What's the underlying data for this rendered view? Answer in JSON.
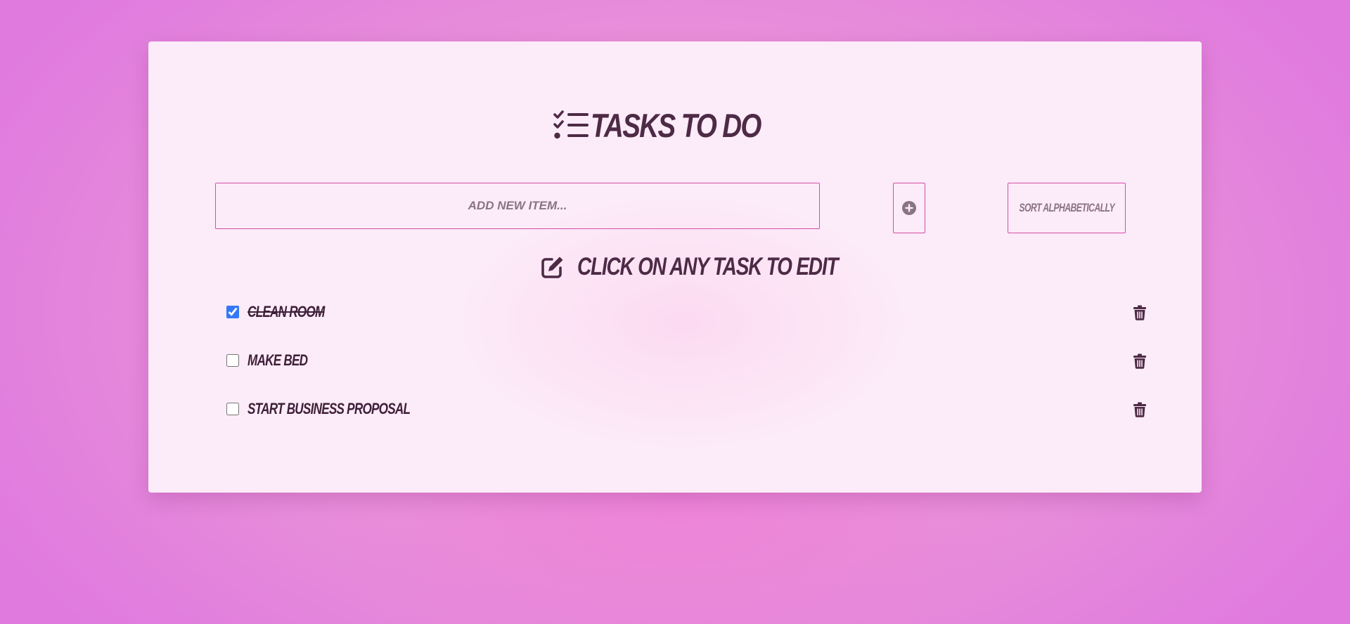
{
  "header": {
    "title": "Tasks To Do",
    "title_icon": "list-check-icon"
  },
  "new_item": {
    "placeholder": "Add new item...",
    "value": ""
  },
  "buttons": {
    "add_icon": "plus-circle-icon",
    "sort_label": "Sort Alphabetically"
  },
  "hint": {
    "icon": "edit-icon",
    "text": "Click on any task to edit"
  },
  "tasks": [
    {
      "label": "Clean Room",
      "completed": true,
      "delete_icon": "trash-icon"
    },
    {
      "label": "Make bed",
      "completed": false,
      "delete_icon": "trash-icon"
    },
    {
      "label": "Start business proposal",
      "completed": false,
      "delete_icon": "trash-icon"
    }
  ],
  "colors": {
    "text_dark": "#4d2a45",
    "border_accent": "#d34fa7",
    "checkbox_accent": "#3478f6",
    "card_background": "#fcebf8",
    "page_background": "#e88fd9"
  }
}
